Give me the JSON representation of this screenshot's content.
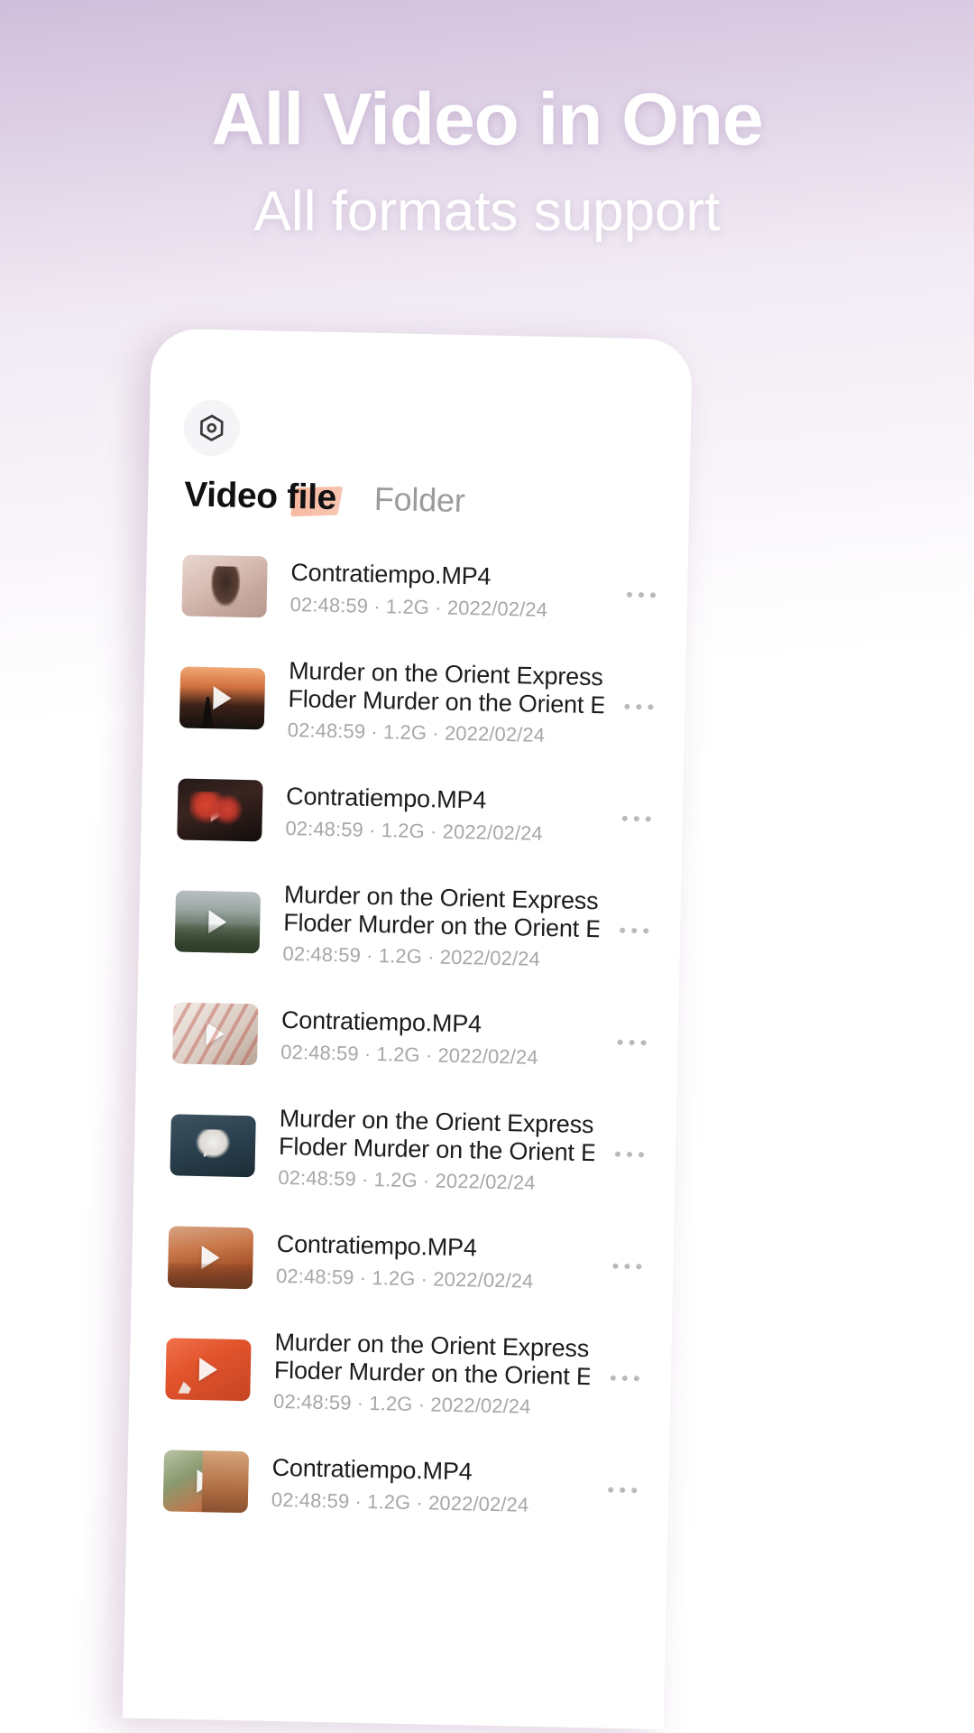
{
  "promo": {
    "headline": "All Video in One",
    "subhead": "All formats support"
  },
  "colors": {
    "bg_top": "#8e5ca8",
    "bg_bottom": "#f7bb92",
    "accent_stroke": "#f7a98c",
    "active_tab": "#111113",
    "inactive_tab": "#9b9b9e",
    "meta_text": "#a7a7ab",
    "title_text": "#1c1c1e"
  },
  "app": {
    "settings_icon": "hexagon-settings-icon",
    "tabs": [
      {
        "label": "Video file",
        "active": true
      },
      {
        "label": "Folder",
        "active": false
      }
    ],
    "row_menu_icon": "more-horizontal-icon",
    "play_icon": "play-triangle-icon",
    "items": [
      {
        "title": "Contratiempo.MP4",
        "title2": "",
        "duration": "02:48:59",
        "size": "1.2G",
        "date": "2022/02/24",
        "meta": "02:48:59 · 1.2G · 2022/02/24",
        "thumb_class": "t0"
      },
      {
        "title": "Murder on the Orient Express",
        "title2": "Floder Murder on the Orient Expr...",
        "duration": "02:48:59",
        "size": "1.2G",
        "date": "2022/02/24",
        "meta": "02:48:59 · 1.2G · 2022/02/24",
        "thumb_class": "t1"
      },
      {
        "title": "Contratiempo.MP4",
        "title2": "",
        "duration": "02:48:59",
        "size": "1.2G",
        "date": "2022/02/24",
        "meta": "02:48:59 · 1.2G · 2022/02/24",
        "thumb_class": "t2"
      },
      {
        "title": "Murder on the Orient Express",
        "title2": "Floder Murder on the Orient Expr...",
        "duration": "02:48:59",
        "size": "1.2G",
        "date": "2022/02/24",
        "meta": "02:48:59 · 1.2G · 2022/02/24",
        "thumb_class": "t3"
      },
      {
        "title": "Contratiempo.MP4",
        "title2": "",
        "duration": "02:48:59",
        "size": "1.2G",
        "date": "2022/02/24",
        "meta": "02:48:59 · 1.2G · 2022/02/24",
        "thumb_class": "t4"
      },
      {
        "title": "Murder on the Orient Express",
        "title2": "Floder Murder on the Orient Expr...",
        "duration": "02:48:59",
        "size": "1.2G",
        "date": "2022/02/24",
        "meta": "02:48:59 · 1.2G · 2022/02/24",
        "thumb_class": "t5"
      },
      {
        "title": "Contratiempo.MP4",
        "title2": "",
        "duration": "02:48:59",
        "size": "1.2G",
        "date": "2022/02/24",
        "meta": "02:48:59 · 1.2G · 2022/02/24",
        "thumb_class": "t6"
      },
      {
        "title": "Murder on the Orient Express",
        "title2": "Floder Murder on the Orient Expr...",
        "duration": "02:48:59",
        "size": "1.2G",
        "date": "2022/02/24",
        "meta": "02:48:59 · 1.2G · 2022/02/24",
        "thumb_class": "t7"
      },
      {
        "title": "Contratiempo.MP4",
        "title2": "",
        "duration": "02:48:59",
        "size": "1.2G",
        "date": "2022/02/24",
        "meta": "02:48:59 · 1.2G · 2022/02/24",
        "thumb_class": "t8"
      }
    ]
  }
}
